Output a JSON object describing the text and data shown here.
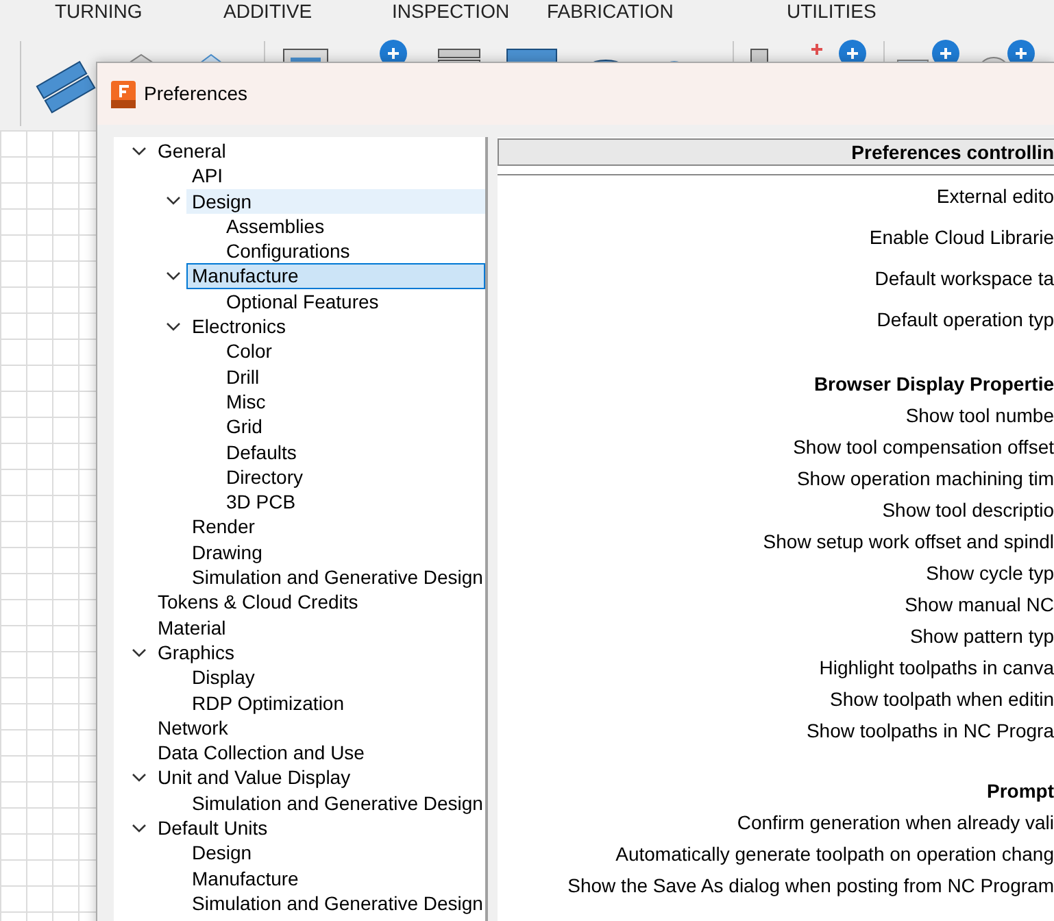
{
  "ribbon_tabs": [
    "TURNING",
    "ADDITIVE",
    "INSPECTION",
    "FABRICATION",
    "UTILITIES"
  ],
  "dialog": {
    "title": "Preferences",
    "tree": [
      {
        "label": "General",
        "expanded": true,
        "selected": false,
        "hovered": false,
        "children": [
          {
            "label": "API",
            "selected": false,
            "hovered": false
          },
          {
            "label": "Design",
            "expanded": true,
            "selected": false,
            "hovered": true,
            "children": [
              {
                "label": "Assemblies",
                "selected": false,
                "hovered": false
              },
              {
                "label": "Configurations",
                "selected": false,
                "hovered": false
              }
            ]
          },
          {
            "label": "Manufacture",
            "expanded": true,
            "selected": true,
            "hovered": false,
            "children": [
              {
                "label": "Optional Features",
                "selected": false,
                "hovered": false
              }
            ]
          },
          {
            "label": "Electronics",
            "expanded": true,
            "selected": false,
            "hovered": false,
            "children": [
              {
                "label": "Color",
                "selected": false,
                "hovered": false
              },
              {
                "label": "Drill",
                "selected": false,
                "hovered": false
              },
              {
                "label": "Misc",
                "selected": false,
                "hovered": false
              },
              {
                "label": "Grid",
                "selected": false,
                "hovered": false
              },
              {
                "label": "Defaults",
                "selected": false,
                "hovered": false
              },
              {
                "label": "Directory",
                "selected": false,
                "hovered": false
              },
              {
                "label": "3D PCB",
                "selected": false,
                "hovered": false
              }
            ]
          },
          {
            "label": "Render",
            "selected": false,
            "hovered": false
          },
          {
            "label": "Drawing",
            "selected": false,
            "hovered": false
          },
          {
            "label": "Simulation and Generative Design",
            "selected": false,
            "hovered": false
          }
        ]
      },
      {
        "label": "Tokens & Cloud Credits",
        "selected": false,
        "hovered": false
      },
      {
        "label": "Material",
        "selected": false,
        "hovered": false
      },
      {
        "label": "Graphics",
        "expanded": true,
        "selected": false,
        "hovered": false,
        "children": [
          {
            "label": "Display",
            "selected": false,
            "hovered": false
          },
          {
            "label": "RDP Optimization",
            "selected": false,
            "hovered": false
          }
        ]
      },
      {
        "label": "Network",
        "selected": false,
        "hovered": false
      },
      {
        "label": "Data Collection and Use",
        "selected": false,
        "hovered": false
      },
      {
        "label": "Unit and Value Display",
        "expanded": true,
        "selected": false,
        "hovered": false,
        "children": [
          {
            "label": "Simulation and Generative Design",
            "selected": false,
            "hovered": false
          }
        ]
      },
      {
        "label": "Default Units",
        "expanded": true,
        "selected": false,
        "hovered": false,
        "children": [
          {
            "label": "Design",
            "selected": false,
            "hovered": false
          },
          {
            "label": "Manufacture",
            "selected": false,
            "hovered": false
          },
          {
            "label": "Simulation and Generative Design",
            "selected": false,
            "hovered": false
          }
        ]
      }
    ],
    "panel_header": "Preferences controllin",
    "settings": [
      {
        "kind": "field",
        "label": "External edito"
      },
      {
        "kind": "field",
        "label": "Enable Cloud Librarie"
      },
      {
        "kind": "field",
        "label": "Default workspace ta"
      },
      {
        "kind": "field",
        "label": "Default operation typ"
      },
      {
        "kind": "heading",
        "label": "Browser Display Propertie"
      },
      {
        "kind": "check",
        "label": "Show tool numbe"
      },
      {
        "kind": "check",
        "label": "Show tool compensation offset"
      },
      {
        "kind": "check",
        "label": "Show operation machining tim"
      },
      {
        "kind": "check",
        "label": "Show tool descriptio"
      },
      {
        "kind": "check",
        "label": "Show setup work offset and spindl"
      },
      {
        "kind": "check",
        "label": "Show cycle typ"
      },
      {
        "kind": "check",
        "label": "Show manual NC"
      },
      {
        "kind": "check",
        "label": "Show pattern typ"
      },
      {
        "kind": "check",
        "label": "Highlight toolpaths in canva"
      },
      {
        "kind": "check",
        "label": "Show toolpath when editin"
      },
      {
        "kind": "check",
        "label": "Show toolpaths in NC Progra"
      },
      {
        "kind": "heading",
        "label": "Prompt"
      },
      {
        "kind": "check",
        "label": "Confirm generation when already vali"
      },
      {
        "kind": "check",
        "label": "Automatically generate toolpath on operation chang"
      },
      {
        "kind": "check",
        "label": "Show the Save As dialog when posting from NC Program"
      }
    ]
  }
}
